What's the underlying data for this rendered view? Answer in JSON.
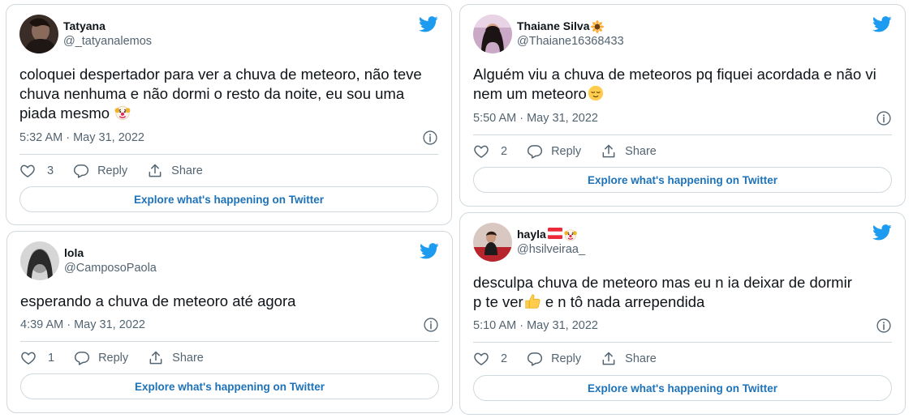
{
  "colors": {
    "twitter_blue": "#1d9bf0",
    "link": "#1d72b8",
    "secondary_text": "#536471",
    "border": "#cfd9de"
  },
  "tweets": [
    {
      "name": "Tatyana",
      "handle": "@_tatyanalemos",
      "text": "coloquei despertador para ver a chuva de meteoro, não teve chuva nenhuma e não dormi o resto da noite, eu sou uma piada mesmo",
      "text_emoji": "clown-face-emoji",
      "time": "5:32 AM · May 31, 2022",
      "likes": "3",
      "reply_label": "Reply",
      "share_label": "Share",
      "explore_label": "Explore what's happening on Twitter"
    },
    {
      "name": "lola",
      "handle": "@CamposoPaola",
      "text": "esperando a chuva de meteoro até agora",
      "time": "4:39 AM · May 31, 2022",
      "likes": "1",
      "reply_label": "Reply",
      "share_label": "Share",
      "explore_label": "Explore what's happening on Twitter"
    },
    {
      "name": "Thaiane Silva",
      "name_emoji": "sunflower-emoji",
      "handle": "@Thaiane16368433",
      "text": "Alguém viu a chuva de meteoros pq fiquei acordada e não vi nem um meteoro",
      "text_emoji": "relieved-face-emoji",
      "time": "5:50 AM · May 31, 2022",
      "likes": "2",
      "reply_label": "Reply",
      "share_label": "Share",
      "explore_label": "Explore what's happening on Twitter"
    },
    {
      "name": "hayla",
      "name_emoji": "austria-flag-and-clown-emoji",
      "handle": "@hsilveiraa_",
      "text_line1": "desculpa chuva de meteoro mas eu n ia deixar de dormir",
      "text_line2a": "p te ver",
      "text_emoji": "thumbs-up-emoji",
      "text_line2b": " e n tô nada arrependida",
      "time": "5:10 AM · May 31, 2022",
      "likes": "2",
      "reply_label": "Reply",
      "share_label": "Share",
      "explore_label": "Explore what's happening on Twitter"
    }
  ]
}
